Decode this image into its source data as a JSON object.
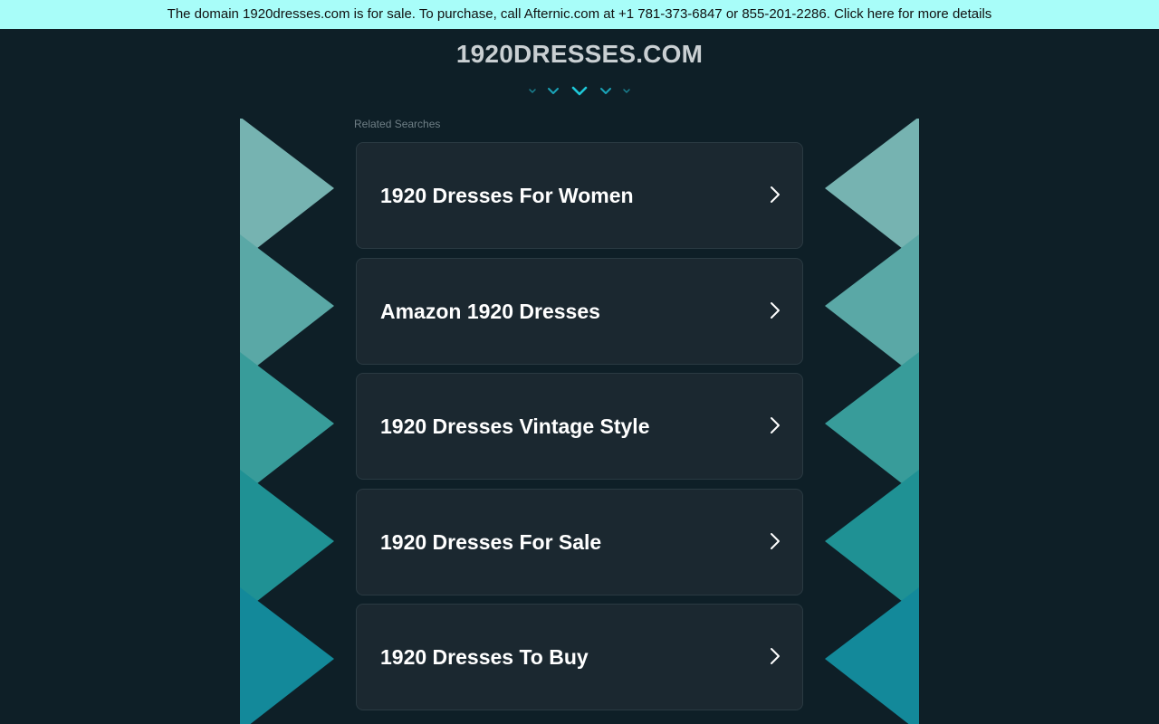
{
  "banner": {
    "text": "The domain 1920dresses.com is for sale. To purchase, call Afternic.com at +1 781-373-6847 or 855-201-2286. Click here for more details"
  },
  "site": {
    "title": "1920DRESSES.COM"
  },
  "related": {
    "label": "Related Searches",
    "items": [
      {
        "label": "1920 Dresses For Women"
      },
      {
        "label": "Amazon 1920 Dresses"
      },
      {
        "label": "1920 Dresses Vintage Style"
      },
      {
        "label": "1920 Dresses For Sale"
      },
      {
        "label": "1920 Dresses To Buy"
      }
    ]
  },
  "icons": {
    "item_arrow": "chevron-right-icon",
    "header_decoration": "chevron-down-icon"
  },
  "colors": {
    "background": "#0e1f27",
    "banner_bg": "#a8fdf9",
    "card_bg": "#1b2830",
    "accent": "#1ec8d8",
    "decor": [
      "#76b3b1",
      "#5aa8a6",
      "#389c9a",
      "#1f9194",
      "#13899a"
    ]
  }
}
